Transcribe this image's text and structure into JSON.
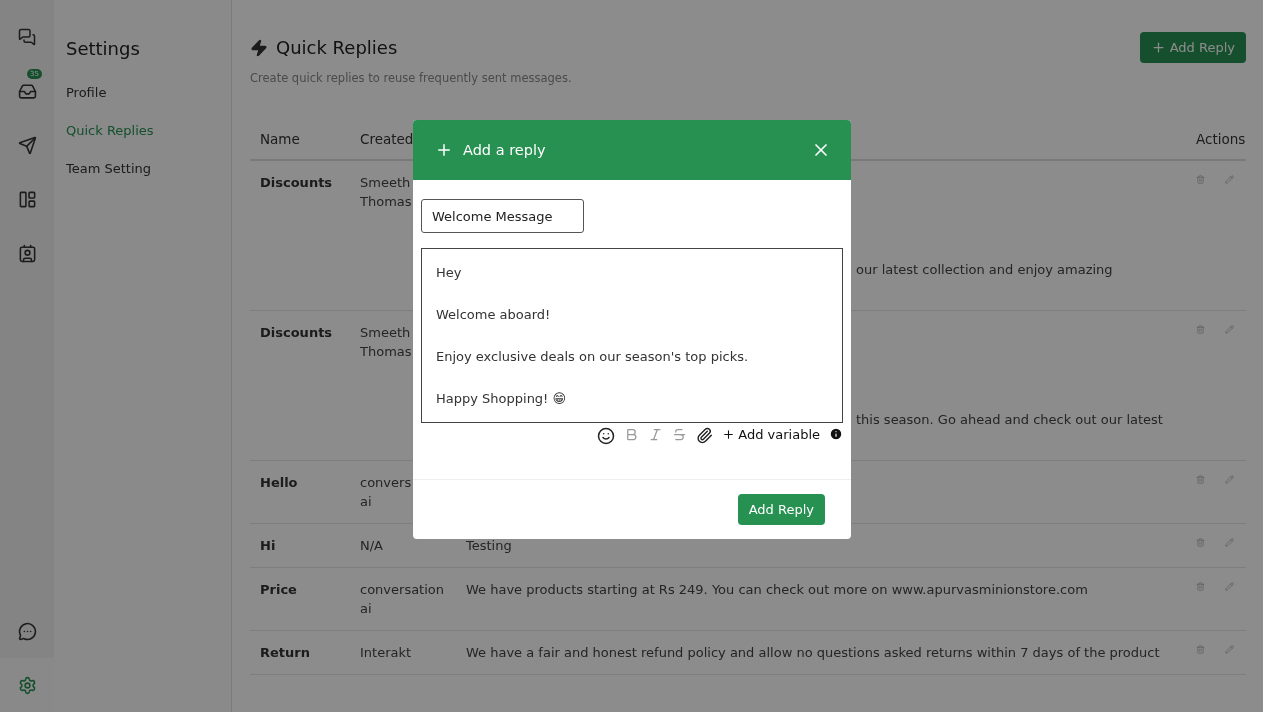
{
  "rail": {
    "items": [
      {
        "selected": false
      },
      {
        "selected": false,
        "badge": "35"
      },
      {
        "selected": false
      },
      {
        "selected": false
      },
      {
        "selected": false
      }
    ],
    "bottom_items": [
      {
        "selected": false
      },
      {
        "selected": true
      }
    ]
  },
  "sidebar": {
    "title": "Settings",
    "items": [
      {
        "label": "Profile",
        "selected": false
      },
      {
        "label": "Quick Replies",
        "selected": true
      },
      {
        "label": "Team Setting",
        "selected": false
      }
    ]
  },
  "page": {
    "title": "Quick Replies",
    "subtitle": "Create quick replies to reuse frequently sent messages.",
    "add_button": "Add Reply"
  },
  "table": {
    "columns": [
      "Name",
      "Created",
      "Actions"
    ],
    "rows": [
      {
        "kind": "covered",
        "name": "Discounts",
        "created_by": [
          "Smeeth",
          "Thomas"
        ],
        "message": "our latest collection and enjoy amazing"
      },
      {
        "kind": "covered",
        "name": "Discounts",
        "created_by": [
          "Smeeth",
          "Thomas"
        ],
        "message": "this season. Go ahead and check out our latest"
      },
      {
        "kind": "hidden",
        "name": "Hello",
        "created_by": [
          "convers",
          "ai"
        ]
      },
      {
        "kind": "full",
        "name": "Hi",
        "created_by": [
          "N/A"
        ],
        "message": "Testing"
      },
      {
        "kind": "full",
        "name": "Price",
        "created_by": [
          "conversation",
          "ai"
        ],
        "message": "We have products starting at Rs 249. You can check out more on www.apurvasminionstore.com"
      },
      {
        "kind": "full",
        "name": "Return",
        "created_by": [
          "Interakt"
        ],
        "message": "We have a fair and honest refund policy and allow no questions asked returns within 7 days of the product"
      }
    ]
  },
  "modal": {
    "title": "Add a reply",
    "name_value": "Welcome Message",
    "body": [
      "Hey",
      "Welcome aboard!",
      "Enjoy exclusive deals on our season's top picks.",
      "Happy Shopping! 😁"
    ],
    "add_variable": "Add variable",
    "submit": "Add Reply"
  }
}
